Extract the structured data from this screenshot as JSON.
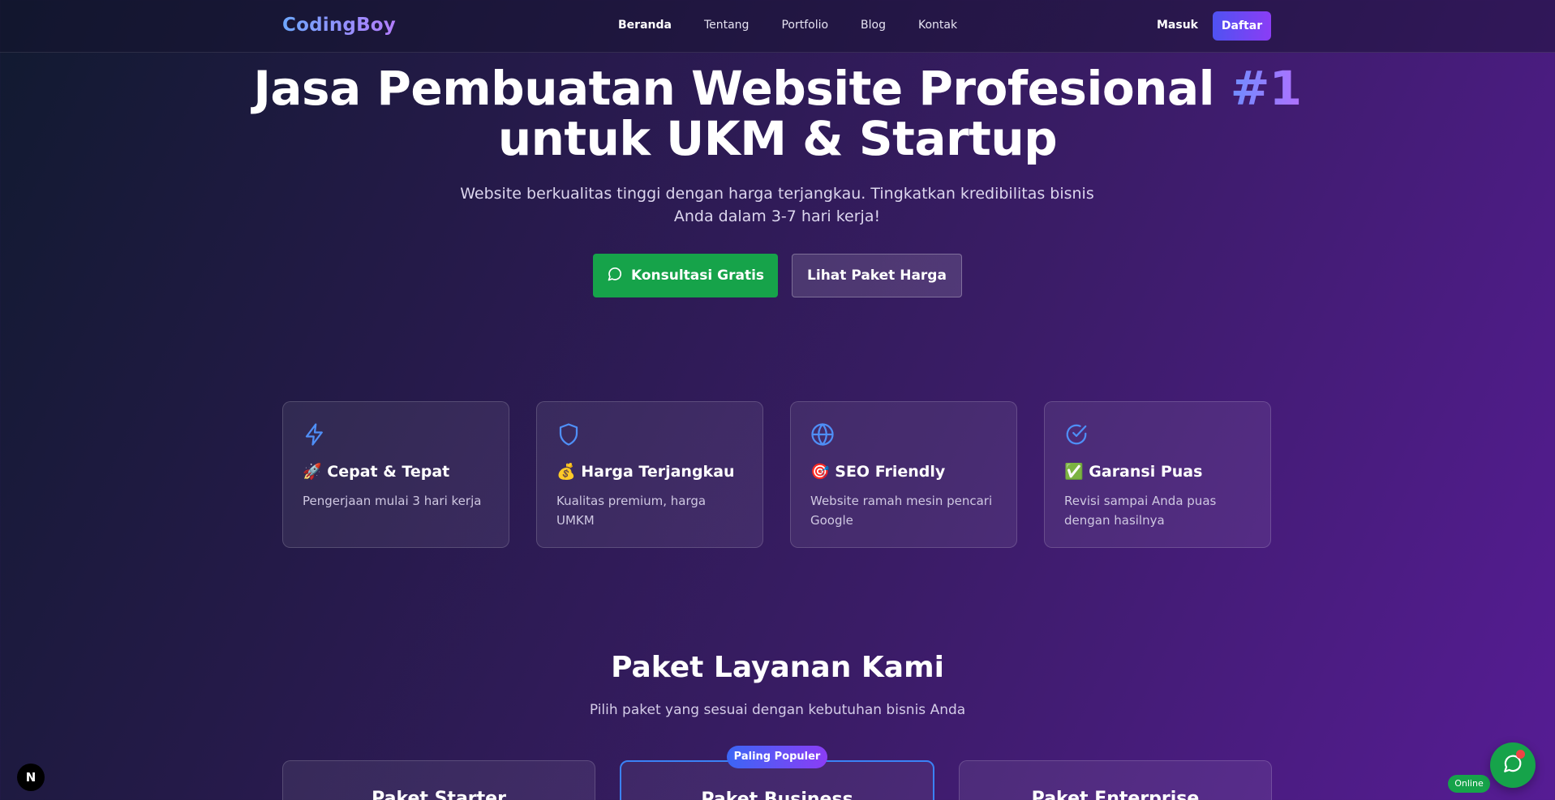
{
  "nav": {
    "logo": "CodingBoy",
    "links": [
      "Beranda",
      "Tentang",
      "Portfolio",
      "Blog",
      "Kontak"
    ],
    "login": "Masuk",
    "register": "Daftar"
  },
  "hero": {
    "title_line1": "Jasa Pembuatan Website Profesional",
    "title_accent": "#1",
    "title_line2": "untuk UKM & Startup",
    "subtitle": "Website berkualitas tinggi dengan harga terjangkau. Tingkatkan kredibilitas bisnis Anda dalam 3-7 hari kerja!",
    "cta_primary": "Konsultasi Gratis",
    "cta_secondary": "Lihat Paket Harga"
  },
  "features": [
    {
      "icon": "lightning-icon",
      "title": "🚀 Cepat & Tepat",
      "desc": "Pengerjaan mulai 3 hari kerja"
    },
    {
      "icon": "shield-icon",
      "title": "💰 Harga Terjangkau",
      "desc": "Kualitas premium, harga UMKM"
    },
    {
      "icon": "globe-icon",
      "title": "🎯 SEO Friendly",
      "desc": "Website ramah mesin pencari Google"
    },
    {
      "icon": "check-circle-icon",
      "title": "✅ Garansi Puas",
      "desc": "Revisi sampai Anda puas dengan hasilnya"
    }
  ],
  "packages": {
    "title": "Paket Layanan Kami",
    "subtitle": "Pilih paket yang sesuai dengan kebutuhan bisnis Anda",
    "badge": "Paling Populer",
    "items": [
      "Paket Starter",
      "Paket Business",
      "Paket Enterprise"
    ]
  },
  "widgets": {
    "next_badge": "N",
    "online": "Online"
  },
  "colors": {
    "accent_blue": "#3b82f6",
    "accent_purple": "#8b3df5",
    "whatsapp_green": "#16a34a",
    "icon_blue": "#4f8ff7"
  }
}
